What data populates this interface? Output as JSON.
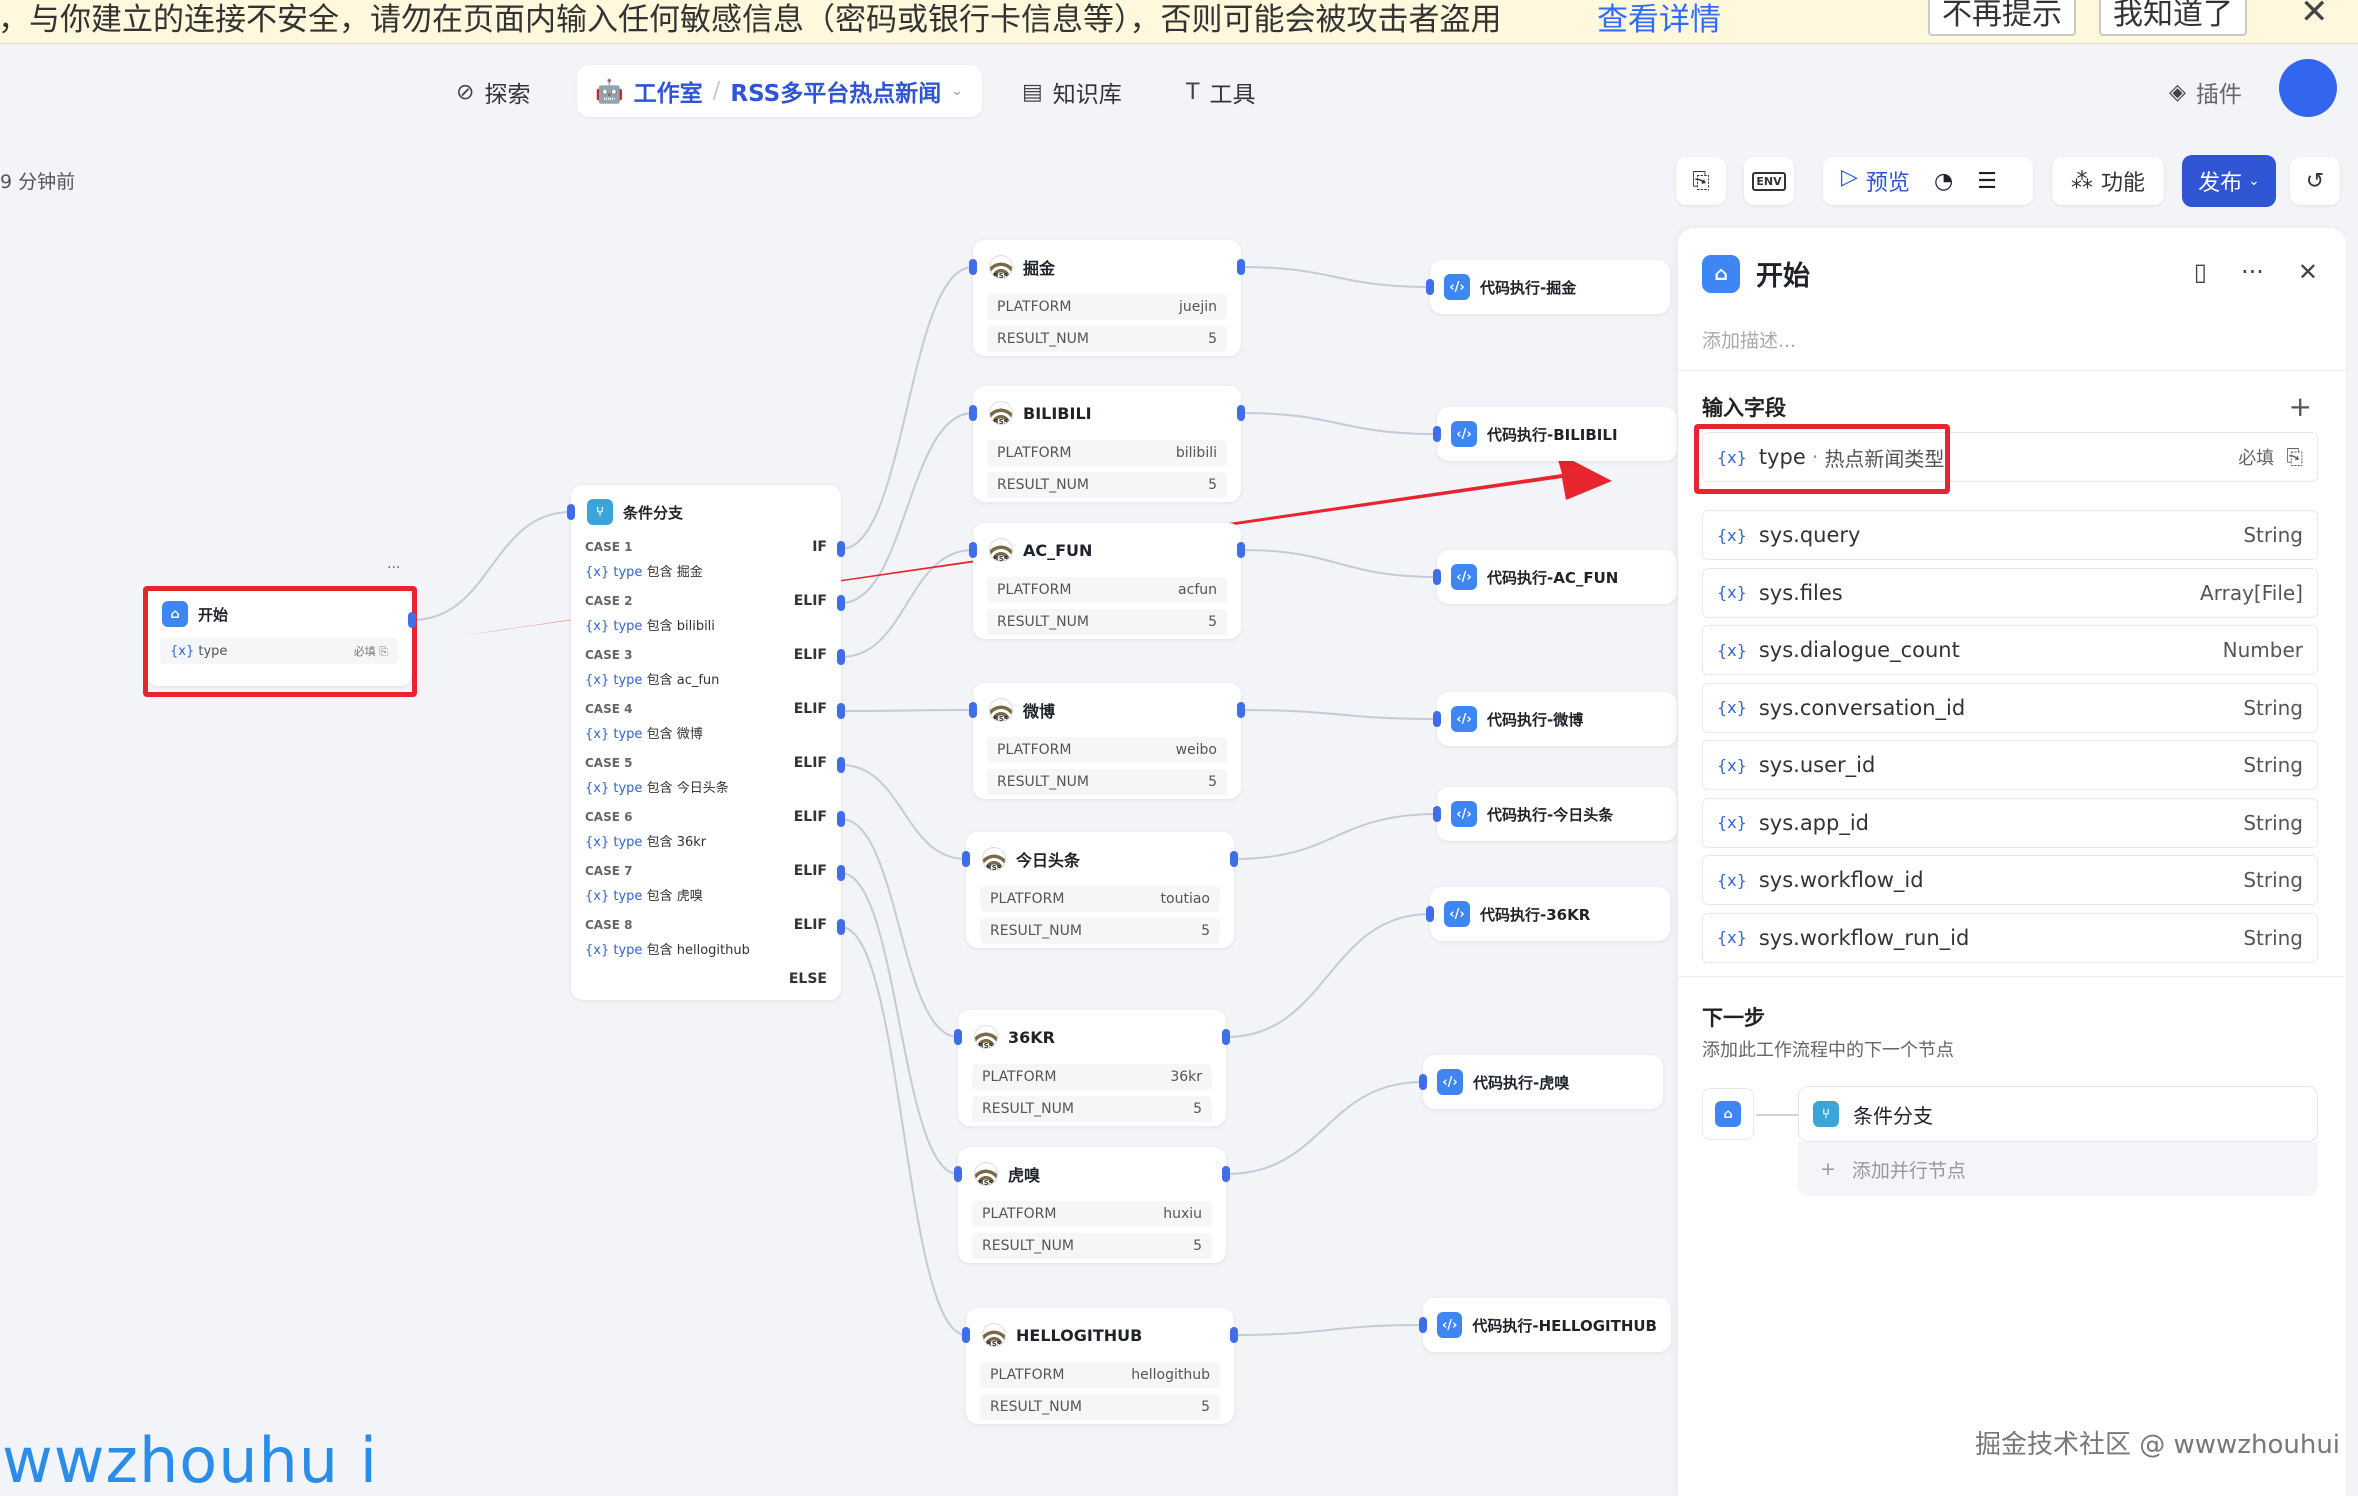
{
  "banner": {
    "message": "，与你建立的连接不安全，请勿在页面内输入任何敏感信息（密码或银行卡信息等），否则可能会被攻击者盗用",
    "link": "查看详情",
    "btn_no_remind": "不再提示",
    "btn_ok": "我知道了",
    "close": "✕"
  },
  "nav": {
    "explore": "探索",
    "studio": "工作室",
    "project": "RSS多平台热点新闻",
    "knowledge": "知识库",
    "tools": "工具",
    "plugins": "插件"
  },
  "toolbar": {
    "saved_time": "9 分钟前",
    "env": "ENV",
    "preview": "预览",
    "features": "功能",
    "publish": "发布"
  },
  "start_node": {
    "title": "开始",
    "field": "type",
    "required": "必填",
    "more": "···"
  },
  "branch_node": {
    "title": "条件分支",
    "cases": [
      {
        "case": "CASE 1",
        "kw": "IF",
        "var": "type",
        "op": "包含",
        "val": "掘金"
      },
      {
        "case": "CASE 2",
        "kw": "ELIF",
        "var": "type",
        "op": "包含",
        "val": "bilibili"
      },
      {
        "case": "CASE 3",
        "kw": "ELIF",
        "var": "type",
        "op": "包含",
        "val": "ac_fun"
      },
      {
        "case": "CASE 4",
        "kw": "ELIF",
        "var": "type",
        "op": "包含",
        "val": "微博"
      },
      {
        "case": "CASE 5",
        "kw": "ELIF",
        "var": "type",
        "op": "包含",
        "val": "今日头条"
      },
      {
        "case": "CASE 6",
        "kw": "ELIF",
        "var": "type",
        "op": "包含",
        "val": "36kr"
      },
      {
        "case": "CASE 7",
        "kw": "ELIF",
        "var": "type",
        "op": "包含",
        "val": "虎嗅"
      },
      {
        "case": "CASE 8",
        "kw": "ELIF",
        "var": "type",
        "op": "包含",
        "val": "hellogithub"
      }
    ],
    "else": "ELSE"
  },
  "rss_nodes": [
    {
      "title": "掘金",
      "platform": "juejin",
      "num": "5"
    },
    {
      "title": "BILIBILI",
      "platform": "bilibili",
      "num": "5"
    },
    {
      "title": "AC_FUN",
      "platform": "acfun",
      "num": "5"
    },
    {
      "title": "微博",
      "platform": "weibo",
      "num": "5"
    },
    {
      "title": "今日头条",
      "platform": "toutiao",
      "num": "5"
    },
    {
      "title": "36KR",
      "platform": "36kr",
      "num": "5"
    },
    {
      "title": "虎嗅",
      "platform": "huxiu",
      "num": "5"
    },
    {
      "title": "HELLOGITHUB",
      "platform": "hellogithub",
      "num": "5"
    }
  ],
  "rss_labels": {
    "platform": "PLATFORM",
    "num": "RESULT_NUM",
    "icon_text": "RSS"
  },
  "code_nodes": [
    "代码执行-掘金",
    "代码执行-BILIBILI",
    "代码执行-AC_FUN",
    "代码执行-微博",
    "代码执行-今日头条",
    "代码执行-36KR",
    "代码执行-虎嗅",
    "代码执行-HELLOGITHUB"
  ],
  "panel": {
    "title": "开始",
    "desc_placeholder": "添加描述...",
    "input_title": "输入字段",
    "main_field": {
      "name": "type",
      "label": "热点新闻类型",
      "required": "必填"
    },
    "sys_fields": [
      {
        "name": "sys.query",
        "type": "String"
      },
      {
        "name": "sys.files",
        "type": "Array[File]"
      },
      {
        "name": "sys.dialogue_count",
        "type": "Number"
      },
      {
        "name": "sys.conversation_id",
        "type": "String"
      },
      {
        "name": "sys.user_id",
        "type": "String"
      },
      {
        "name": "sys.app_id",
        "type": "String"
      },
      {
        "name": "sys.workflow_id",
        "type": "String"
      },
      {
        "name": "sys.workflow_run_id",
        "type": "String"
      }
    ],
    "next_title": "下一步",
    "next_desc": "添加此工作流程中的下一个节点",
    "next_node": "条件分支",
    "add_parallel": "添加并行节点"
  },
  "watermarks": {
    "left": "wwzhouhu i",
    "right": "掘金技术社区 @ wwwzhouhui"
  },
  "colors": {
    "accent": "#2f55d4",
    "highlight": "#e8242e",
    "edge": "#c5cad6"
  }
}
